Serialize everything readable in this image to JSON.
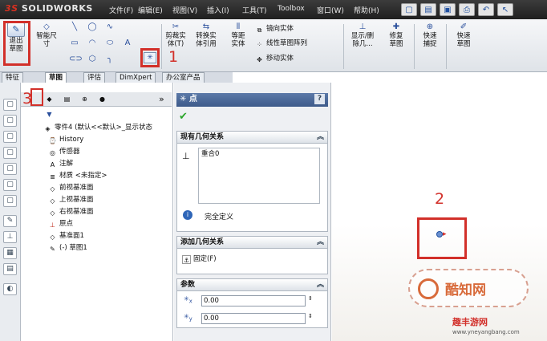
{
  "titlebar": {
    "logo_prefix": "3S",
    "logo_text": "SOLIDWORKS",
    "menus": [
      "文件(F)",
      "编辑(E)",
      "视图(V)",
      "插入(I)",
      "工具(T)",
      "Toolbox",
      "窗口(W)",
      "帮助(H)"
    ]
  },
  "ribbon": {
    "exit_sketch": "退出草图",
    "smart_dim": "智能尺寸",
    "trim": "剪裁实体(T)",
    "convert": "转换实体引用",
    "offset": "等距实体",
    "mirror": "镜向实体",
    "linear_pattern": "线性草图阵列",
    "move": "移动实体",
    "show_delete": "显示/删除几...",
    "repair": "修复草图",
    "quick_snap": "快速捕捉",
    "rapid_sketch": "快速草图"
  },
  "tabs": [
    "特征",
    "草图",
    "评估",
    "DimXpert",
    "办公室产品"
  ],
  "tree": {
    "root": "零件4 (默认<<默认>_显示状态",
    "items": [
      "History",
      "传感器",
      "注解",
      "材质 <未指定>",
      "前视基准面",
      "上视基准面",
      "右视基准面",
      "原点",
      "基准面1",
      "(-) 草图1"
    ]
  },
  "prop": {
    "title": "点",
    "help": "?",
    "existing_header": "现有几何关系",
    "existing_list": [
      "重合0"
    ],
    "status": "完全定义",
    "add_header": "添加几何关系",
    "fix_label": "固定(F)",
    "params_header": "参数",
    "x_value": "0.00",
    "y_value": "0.00",
    "x_label": "x",
    "y_label": "y"
  },
  "annotations": {
    "n1": "1",
    "n2": "2",
    "n3": "3"
  },
  "watermark": {
    "brand": "酷知网",
    "site_cn": "趣丰游网",
    "site_url": "www.yneyangbang.com"
  }
}
